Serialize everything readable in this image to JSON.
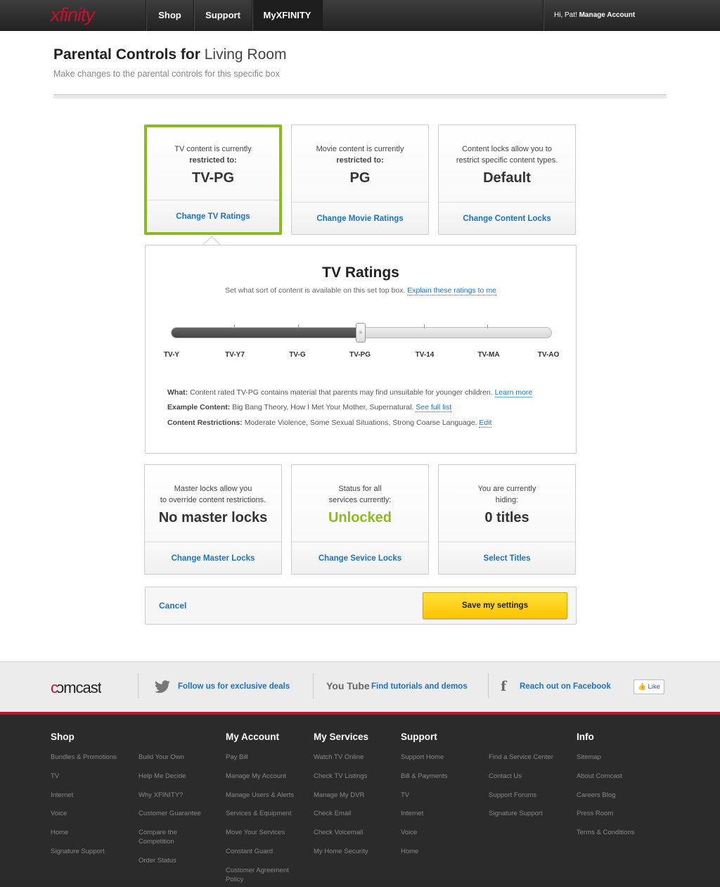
{
  "nav": {
    "logo": "xfinity",
    "shop": "Shop",
    "support": "Support",
    "myxfinity": "MyXFINITY",
    "greeting": "Hi, Pat!",
    "manage": "Manage Account"
  },
  "header": {
    "title_bold": "Parental Controls for",
    "title_light": "Living Room",
    "subtitle": "Make changes to the parental controls for this specific box"
  },
  "cards_top": [
    {
      "text1": "TV content is currently",
      "text2": "restricted to:",
      "value": "TV-PG",
      "action": "Change TV Ratings"
    },
    {
      "text1": "Movie content is currently",
      "text2": "restricted to:",
      "value": "PG",
      "action": "Change Movie Ratings"
    },
    {
      "text1": "Content locks allow you to",
      "text2": "restrict specific content types.",
      "value": "Default",
      "action": "Change Content Locks"
    }
  ],
  "ratings": {
    "title": "TV Ratings",
    "subtitle": "Set what sort of content is available on this set top box.",
    "explain_link": "Explain these ratings to me",
    "levels": [
      "TV-Y",
      "TV-Y7",
      "TV-G",
      "TV-PG",
      "TV-14",
      "TV-MA",
      "TV-AO"
    ],
    "selected_index": 3,
    "thumb_glyph": "≡",
    "what_label": "What:",
    "what_text": "Content rated TV-PG contains material that parents may find unsuitable for younger children.",
    "what_link": "Learn more",
    "example_label": "Example Content:",
    "example_text": "Big Bang Theory, How I Met Your Mother, Supernatural.",
    "example_link": "See full list",
    "restrict_label": "Content Restrictions:",
    "restrict_text": "Moderate Violence, Some Sexual Situations, Strong Coarse Language.",
    "restrict_link": "Edit"
  },
  "cards_bottom": [
    {
      "text1": "Master locks allow you",
      "text2": "to override content restrictions.",
      "value": "No master locks",
      "action": "Change Master Locks"
    },
    {
      "text1": "Status for all",
      "text2": "services currently:",
      "value": "Unlocked",
      "action": "Change Sevice Locks"
    },
    {
      "text1": "You are currently",
      "text2": "hiding:",
      "value": "0 titles",
      "action": "Select Titles"
    }
  ],
  "actions": {
    "cancel": "Cancel",
    "save": "Save my settings"
  },
  "social": {
    "brand": "comcast",
    "twitter": "Follow us for exclusive deals",
    "youtube_icon": "You Tube",
    "youtube": "Find tutorials and demos",
    "facebook_icon": "f",
    "facebook": "Reach out on Facebook",
    "like": "Like"
  },
  "footer": {
    "shop": {
      "title": "Shop",
      "col1": [
        "Bundles & Promotions",
        "TV",
        "Internet",
        "Voice",
        "Home",
        "Signature Support"
      ],
      "col2": [
        "Build Your Own",
        "Help Me Decide",
        "Why XFINITY?",
        "Customer Guarantee",
        "Compare the Competition",
        "Order Status"
      ]
    },
    "account": {
      "title": "My Account",
      "items": [
        "Pay Bill",
        "Manage My Account",
        "Manage Users & Alerts",
        "Services & Equipment",
        "Move Your Services",
        "Constant Guard",
        "Customer Agreement Policy"
      ]
    },
    "services": {
      "title": "My Services",
      "items": [
        "Watch TV Online",
        "Check TV Listings",
        "Manage My DVR",
        "Check Email",
        "Check Voicemail",
        "My Home Security"
      ]
    },
    "support": {
      "title": "Support",
      "col1": [
        "Support Home",
        "Bill & Payments",
        "TV",
        "Internet",
        "Voice",
        "Home"
      ],
      "col2": [
        "Find a Service Center",
        "Contact Us",
        "Support Forums",
        "Signature Support"
      ]
    },
    "info": {
      "title": "Info",
      "items": [
        "Sitemap",
        "About Comcast",
        "Careers Blog",
        "Press Room",
        "Terms & Conditions"
      ]
    }
  },
  "colors": {
    "accent_green": "#8dbb1e",
    "link_blue": "#1a73c8",
    "brand_red": "#c8102e",
    "save_yellow": "#ffc400"
  }
}
